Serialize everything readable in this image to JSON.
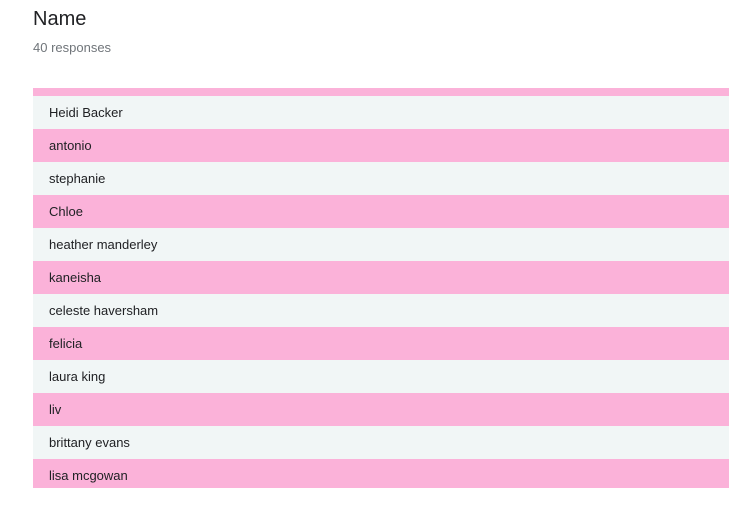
{
  "question": {
    "title": "Name",
    "response_count_text": "40 responses"
  },
  "colors": {
    "accent_pink": "#fbb2d9",
    "row_light": "#f1f6f6",
    "text_primary": "#202124",
    "text_secondary": "#70757a"
  },
  "responses": [
    "Heidi Backer",
    "antonio",
    "stephanie",
    "Chloe",
    "heather manderley",
    "kaneisha",
    "celeste haversham",
    "felicia",
    "laura king",
    "liv",
    "brittany evans",
    "lisa mcgowan"
  ]
}
